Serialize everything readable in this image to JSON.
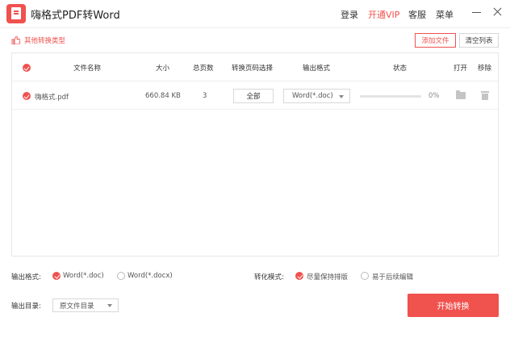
{
  "app": {
    "title": "嗨格式PDF转Word",
    "nav": {
      "login": "登录",
      "vip": "开通VIP",
      "service": "客服",
      "menu": "菜单"
    }
  },
  "toolbar": {
    "other_types": "其他转换类型",
    "add_file": "添加文件",
    "clear_list": "清空列表"
  },
  "table": {
    "columns": [
      "文件名称",
      "大小",
      "总页数",
      "转换页码选择",
      "输出格式",
      "状态",
      "打开",
      "移除"
    ],
    "rows": [
      {
        "name": "嗨格式.pdf",
        "size": "660.84 KB",
        "pages": "3",
        "page_select": "全部",
        "format": "Word(*.doc)",
        "progress": 0,
        "percent": "0%"
      }
    ]
  },
  "options": {
    "output_format_label": "输出格式:",
    "format_doc": "Word(*.doc)",
    "format_docx": "Word(*.docx)",
    "selected_format": "doc",
    "mode_label": "转化模式:",
    "mode_keep": "尽量保持排版",
    "mode_edit": "易于后续编辑",
    "selected_mode": "keep",
    "output_dir_label": "输出目录:",
    "output_dir": "原文件目录"
  },
  "start_button": "开始转换",
  "colors": {
    "accent": "#f0524e"
  },
  "icons": {
    "logo": "pdf-app-logo-icon",
    "thumb": "thumbs-up-icon",
    "check": "check-circle-icon",
    "folder": "folder-icon",
    "trash": "trash-icon",
    "minimize": "minimize-icon",
    "close": "close-icon"
  }
}
